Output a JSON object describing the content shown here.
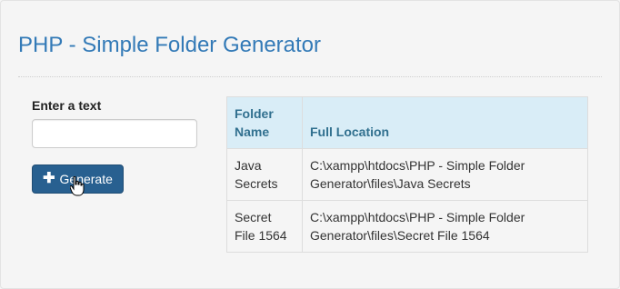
{
  "page": {
    "title": "PHP - Simple Folder Generator"
  },
  "form": {
    "label": "Enter a text",
    "input_value": "",
    "generate_label": "Generate",
    "generate_icon": "plus-icon"
  },
  "table": {
    "headers": [
      "Folder Name",
      "Full Location"
    ],
    "rows": [
      [
        "Java Secrets",
        "C:\\xampp\\htdocs\\PHP - Simple Folder Generator\\files\\Java Secrets"
      ],
      [
        "Secret File 1564",
        "C:\\xampp\\htdocs\\PHP - Simple Folder Generator\\files\\Secret File 1564"
      ]
    ]
  },
  "colors": {
    "title": "#337ab7",
    "button": "#286090",
    "table_header_bg": "#d9edf7",
    "table_header_text": "#31708f"
  }
}
